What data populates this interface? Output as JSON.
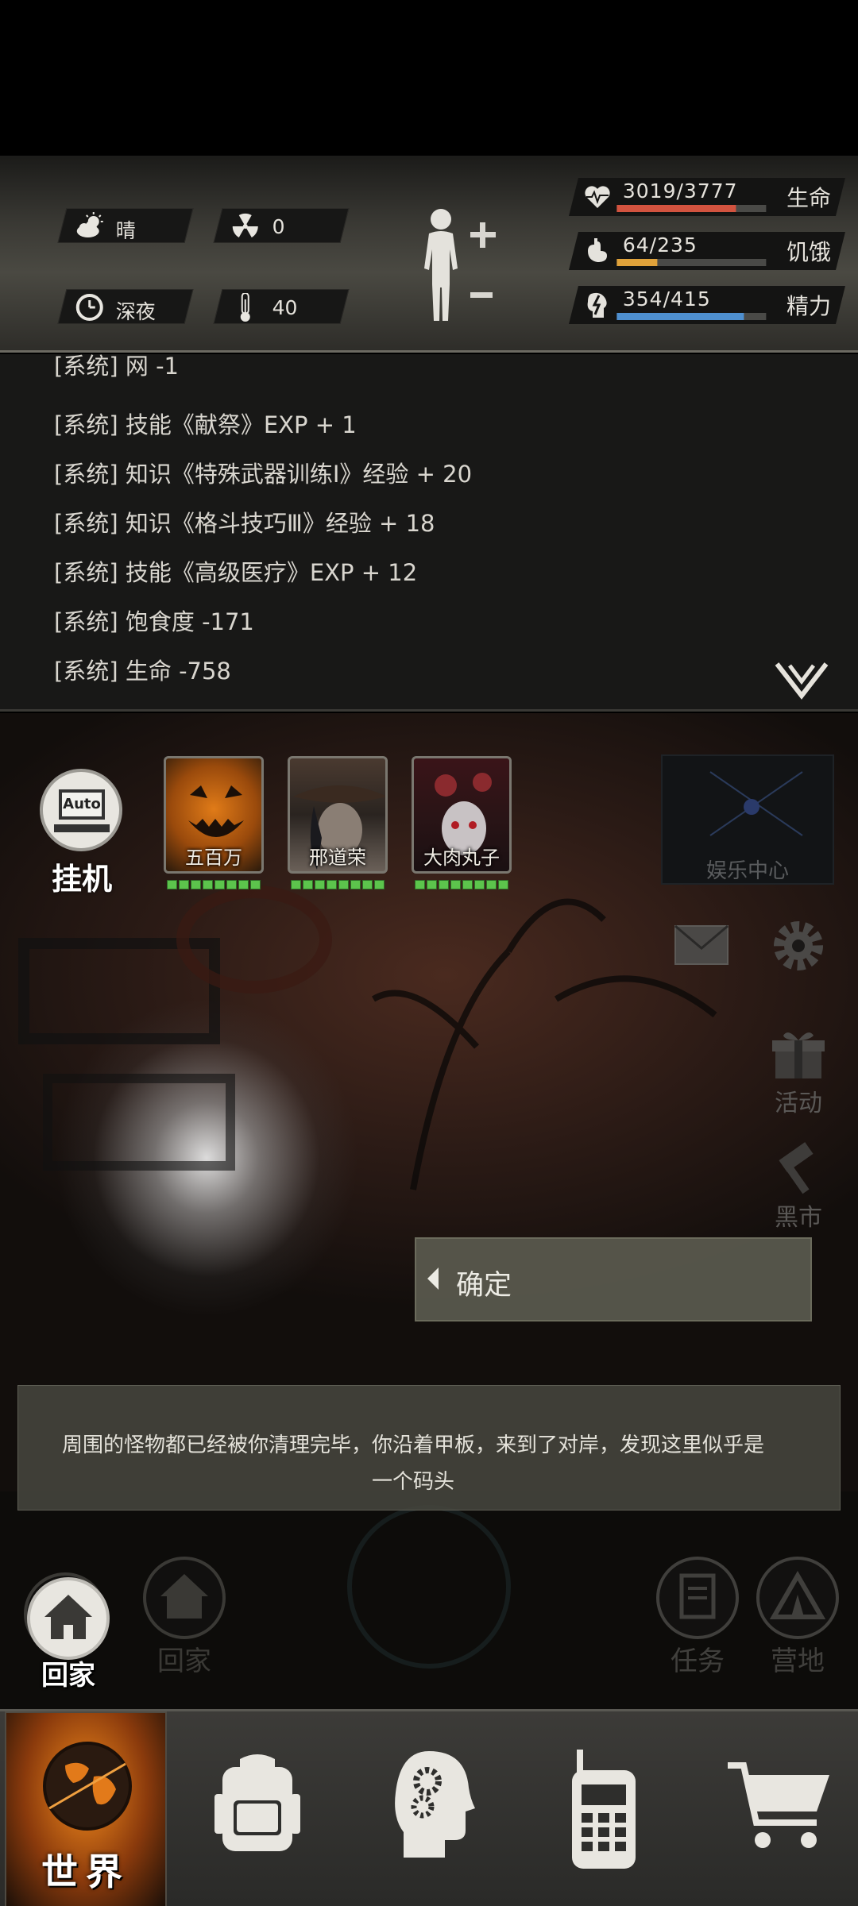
{
  "status": {
    "weather": {
      "icon": "cloud-sun-icon",
      "label": "晴"
    },
    "radiation": {
      "icon": "radiation-icon",
      "value": "0"
    },
    "time": {
      "icon": "clock-icon",
      "label": "深夜"
    },
    "temperature": {
      "icon": "thermometer-icon",
      "value": "40"
    },
    "body_icon": "body-figure-icon",
    "vitals": [
      {
        "icon": "heart-pulse-icon",
        "value": "3019/3777",
        "label": "生命",
        "fill": 0.8,
        "color": "#d2533f"
      },
      {
        "icon": "stomach-icon",
        "value": "64/235",
        "label": "饥饿",
        "fill": 0.27,
        "color": "#e0a23a"
      },
      {
        "icon": "brain-bolt-icon",
        "value": "354/415",
        "label": "精力",
        "fill": 0.85,
        "color": "#4e8fcf"
      }
    ]
  },
  "log": {
    "partial_line": "[系统] 网 -1",
    "lines": [
      "[系统] 技能《献祭》EXP + 1",
      "[系统] 知识《特殊武器训练Ⅰ》经验 + 20",
      "[系统] 知识《格斗技巧Ⅲ》经验 + 18",
      "[系统] 技能《高级医疗》EXP + 12",
      "[系统] 饱食度 -171",
      "[系统] 生命 -758"
    ]
  },
  "scene": {
    "auto_button": {
      "badge": "Auto",
      "label": "挂机"
    },
    "party": [
      {
        "name": "五百万",
        "hp_segments": 8
      },
      {
        "name": "邢道荣",
        "hp_segments": 8
      },
      {
        "name": "大肉丸子",
        "hp_segments": 8
      }
    ],
    "entertainment_label": "娱乐中心",
    "mail_icon": "mail-icon",
    "settings_icon": "gear-icon",
    "activity_label": "活动",
    "black_market_label": "黑市",
    "confirm_label": "确定",
    "message": "周围的怪物都已经被你清理完毕，你沿着甲板，来到了对岸，发现这里似乎是一个码头",
    "home_button_label": "回家",
    "home_ghost_label": "回家",
    "task_label": "任务",
    "camp_label": "营地"
  },
  "nav": {
    "world_label": "世界",
    "items": [
      {
        "icon": "globe-icon"
      },
      {
        "icon": "backpack-icon"
      },
      {
        "icon": "head-gears-icon"
      },
      {
        "icon": "walkie-talkie-icon"
      },
      {
        "icon": "shopping-cart-icon"
      }
    ]
  }
}
